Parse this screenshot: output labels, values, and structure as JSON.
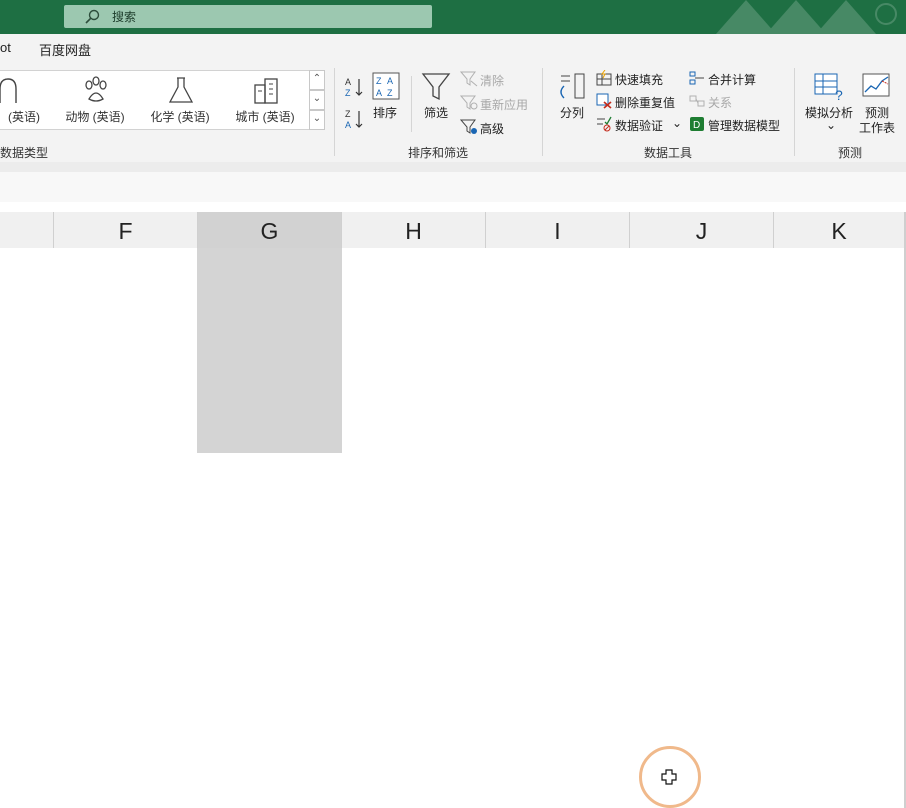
{
  "search": {
    "placeholder_text": "搜索",
    "icon": "search-icon"
  },
  "tabs": {
    "partial_left": "ot",
    "baidu": "百度网盘"
  },
  "ribbon": {
    "data_types_group": {
      "label": "数据类型",
      "items": [
        {
          "label": "人物 (英语)",
          "partial_label": "(英语)",
          "icon": "person-icon"
        },
        {
          "label": "动物 (英语)",
          "icon": "paw-icon"
        },
        {
          "label": "化学 (英语)",
          "icon": "flask-icon"
        },
        {
          "label": "城市 (英语)",
          "icon": "building-icon"
        }
      ]
    },
    "sort_filter_group": {
      "label": "排序和筛选",
      "sort_label": "排序",
      "filter_label": "筛选",
      "clear_label": "清除",
      "reapply_label": "重新应用",
      "advanced_label": "高级"
    },
    "data_tools_group": {
      "label": "数据工具",
      "split_label": "分列",
      "flash_fill_label": "快速填充",
      "remove_dup_label": "删除重复值",
      "validation_label": "数据验证",
      "consolidate_label": "合并计算",
      "relations_label": "关系",
      "manage_model_label": "管理数据模型"
    },
    "forecast_group": {
      "label": "预测",
      "whatif_label": "模拟分析",
      "forecast_label1": "预测",
      "forecast_label2": "工作表"
    }
  },
  "columns": [
    "F",
    "G",
    "H",
    "I",
    "J",
    "K"
  ],
  "colors": {
    "accent": "#1e6f43",
    "selection": "#d4d4d4",
    "cursor_ring": "#f0b98b"
  }
}
